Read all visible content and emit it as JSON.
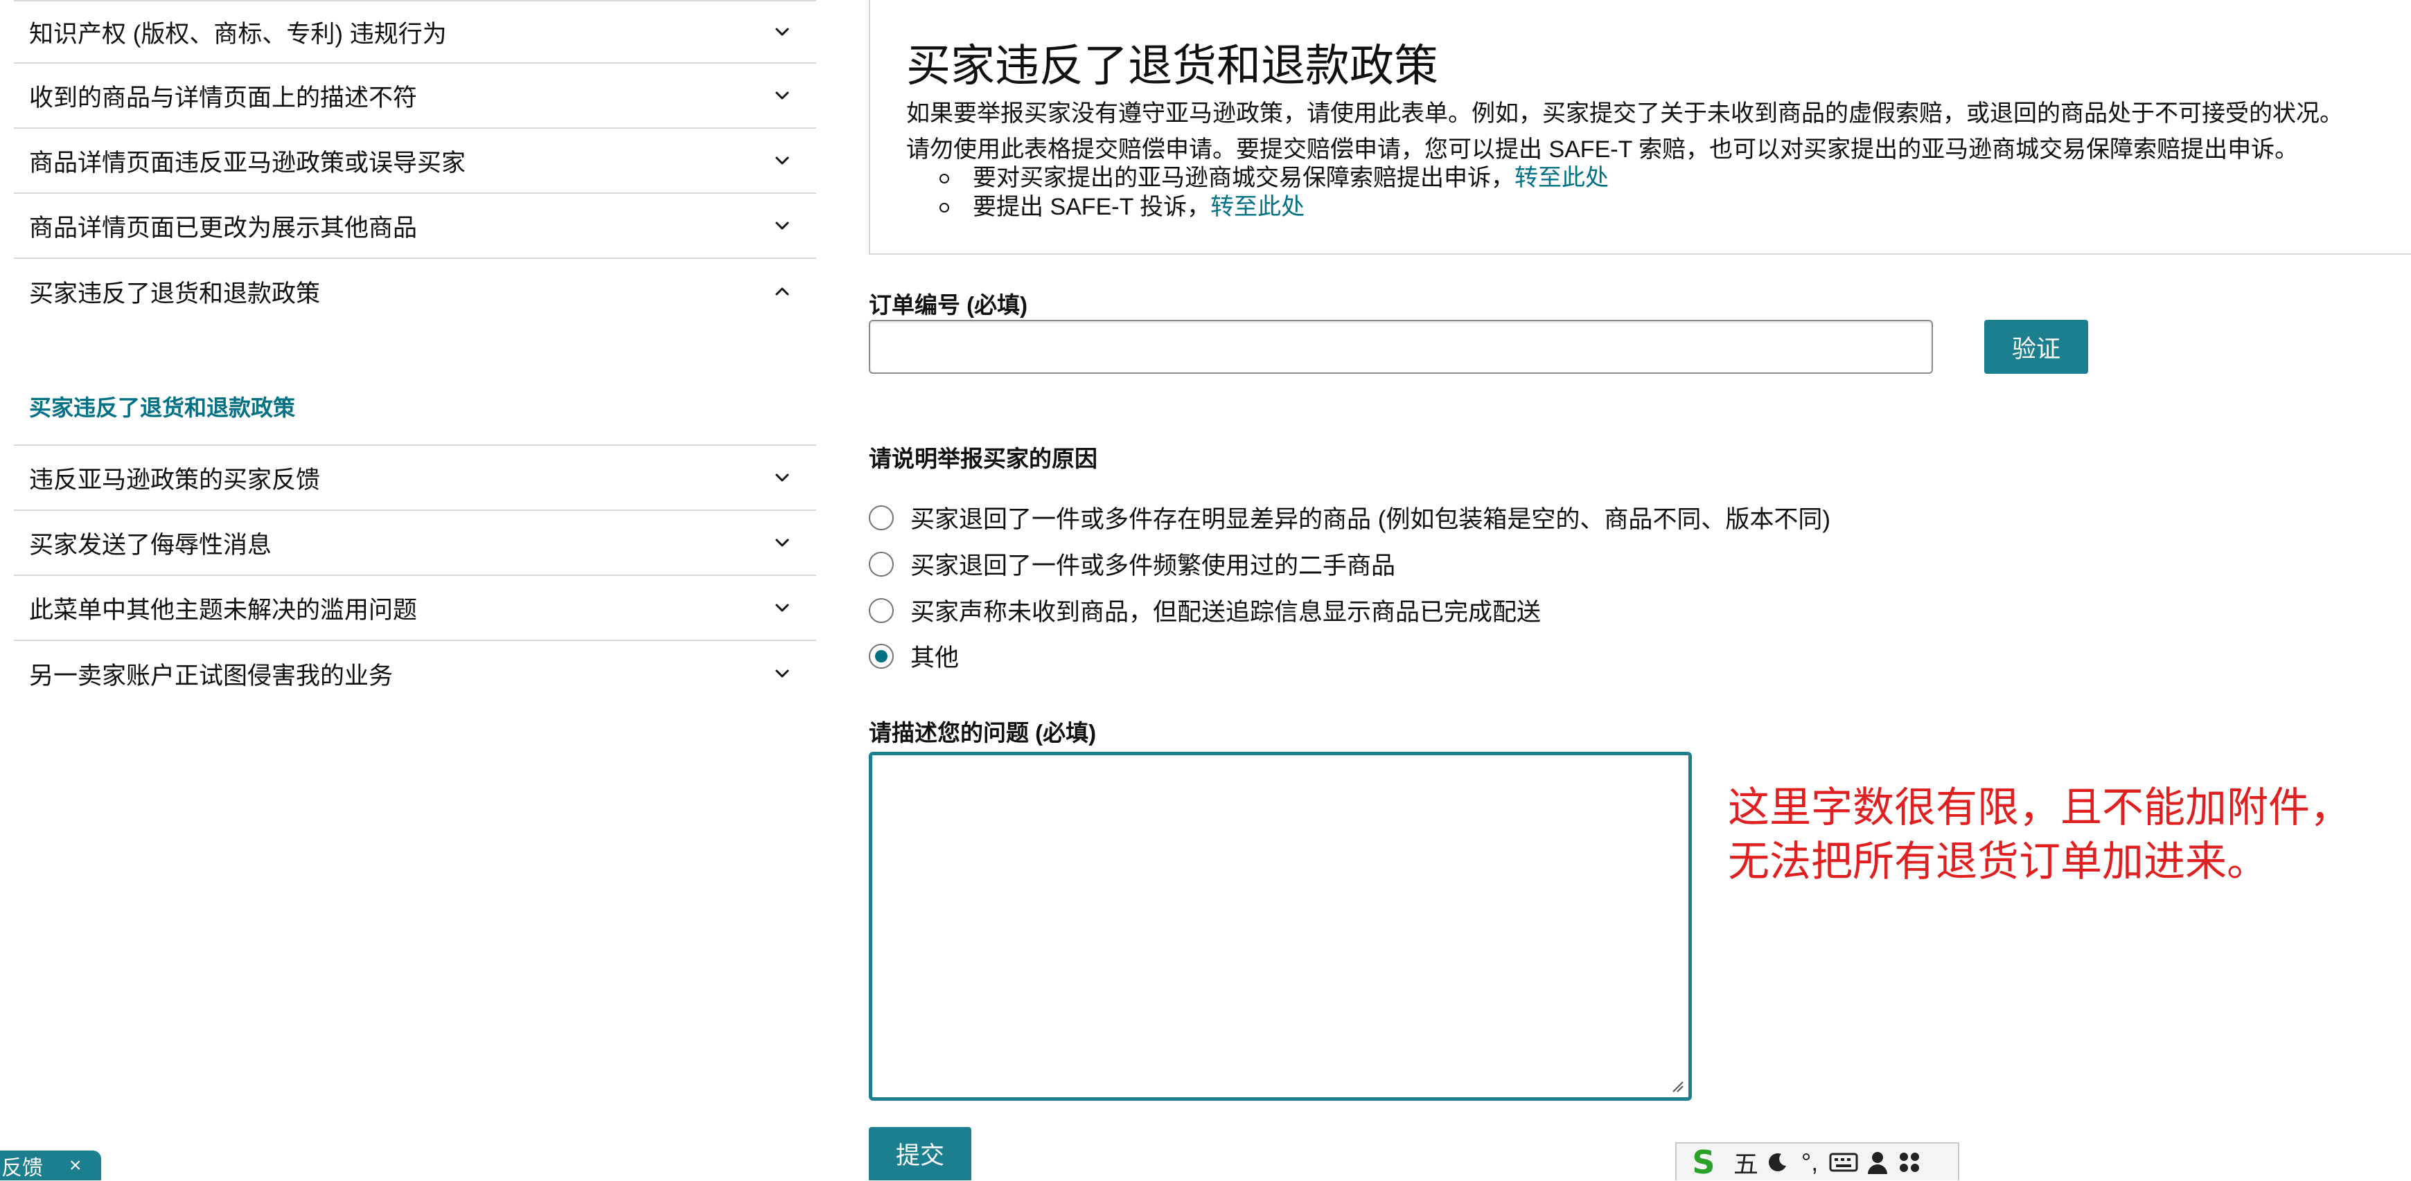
{
  "sidebar": {
    "items": [
      {
        "label": "知识产权 (版权、商标、专利) 违规行为"
      },
      {
        "label": "收到的商品与详情页面上的描述不符"
      },
      {
        "label": "商品详情页面违反亚马逊政策或误导买家"
      },
      {
        "label": "商品详情页面已更改为展示其他商品"
      },
      {
        "label": "买家违反了退货和退款政策"
      }
    ],
    "open_sub_label": "买家违反了退货和退款政策",
    "items_after": [
      {
        "label": "违反亚马逊政策的买家反馈"
      },
      {
        "label": "买家发送了侮辱性消息"
      },
      {
        "label": "此菜单中其他主题未解决的滥用问题"
      },
      {
        "label": "另一卖家账户正试图侵害我的业务"
      }
    ]
  },
  "card": {
    "title": "买家违反了退货和退款政策",
    "desc1": "如果要举报买家没有遵守亚马逊政策，请使用此表单。例如，买家提交了关于未收到商品的虚假索赔，或退回的商品处于不可接受的状况。",
    "desc2": "请勿使用此表格提交赔偿申请。要提交赔偿申请，您可以提出 SAFE-T 索赔，也可以对买家提出的亚马逊商城交易保障索赔提出申诉。",
    "bullets": [
      {
        "text": "要对买家提出的亚马逊商城交易保障索赔提出申诉，",
        "link": "转至此处"
      },
      {
        "text": "要提出 SAFE-T 投诉，",
        "link": "转至此处"
      }
    ]
  },
  "form": {
    "order_label": "订单编号 (必填)",
    "order_value": "",
    "verify_label": "验证",
    "reason_label": "请说明举报买家的原因",
    "reasons": [
      {
        "label": "买家退回了一件或多件存在明显差异的商品 (例如包装箱是空的、商品不同、版本不同)",
        "checked": false
      },
      {
        "label": "买家退回了一件或多件频繁使用过的二手商品",
        "checked": false
      },
      {
        "label": "买家声称未收到商品，但配送追踪信息显示商品已完成配送",
        "checked": false
      },
      {
        "label": "其他",
        "checked": true
      }
    ],
    "describe_label": "请描述您的问题 (必填)",
    "describe_value": "",
    "submit_label": "提交"
  },
  "annotation": {
    "line1": "这里字数很有限，且不能加附件，",
    "line2": "无法把所有退货订单加进来。"
  },
  "ime": {
    "logo": "S",
    "mode_char": "五",
    "punct": "°,",
    "icons": [
      "moon-icon",
      "keyboard-icon",
      "user-icon",
      "apps-icon"
    ]
  },
  "feedback": {
    "label": "反馈",
    "close": "×"
  },
  "colors": {
    "teal": "#007185",
    "button": "#1b7f8f",
    "annotation": "#e02020",
    "border": "#d5d9d9"
  }
}
